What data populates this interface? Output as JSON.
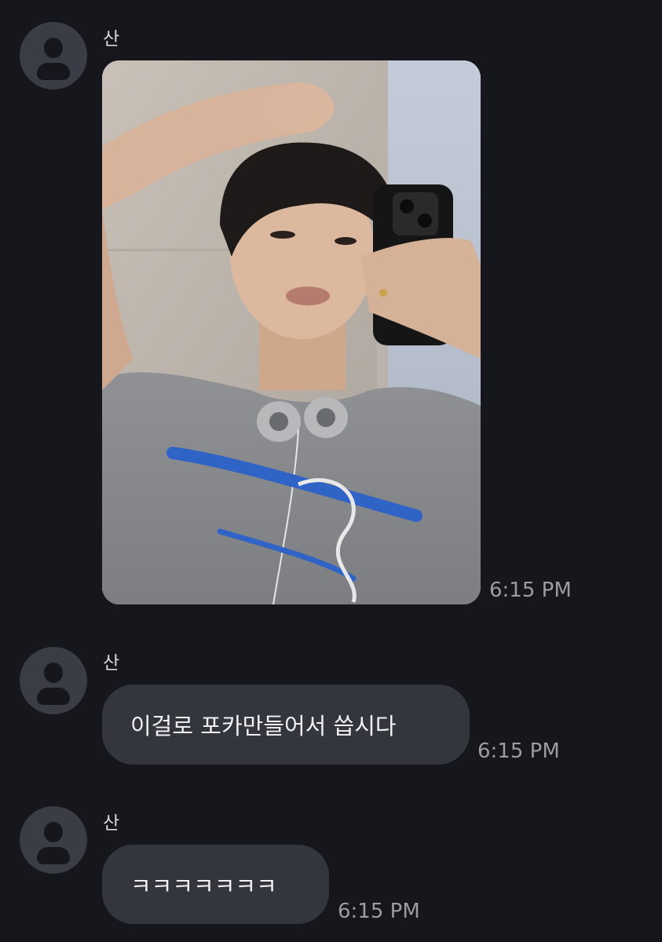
{
  "messages": [
    {
      "sender": "산",
      "type": "image",
      "time": "6:15 PM"
    },
    {
      "sender": "산",
      "type": "text",
      "text": "이걸로 포카만들어서 씁시다",
      "time": "6:15 PM"
    },
    {
      "sender": "산",
      "type": "text",
      "text": "ㅋㅋㅋㅋㅋㅋㅋ",
      "time": "6:15 PM"
    }
  ],
  "colors": {
    "background": "#16171c",
    "bubble": "#34363e",
    "avatar": "#3a3d45",
    "timestamp": "#9c9da3"
  },
  "icons": [
    "user-avatar-icon"
  ]
}
